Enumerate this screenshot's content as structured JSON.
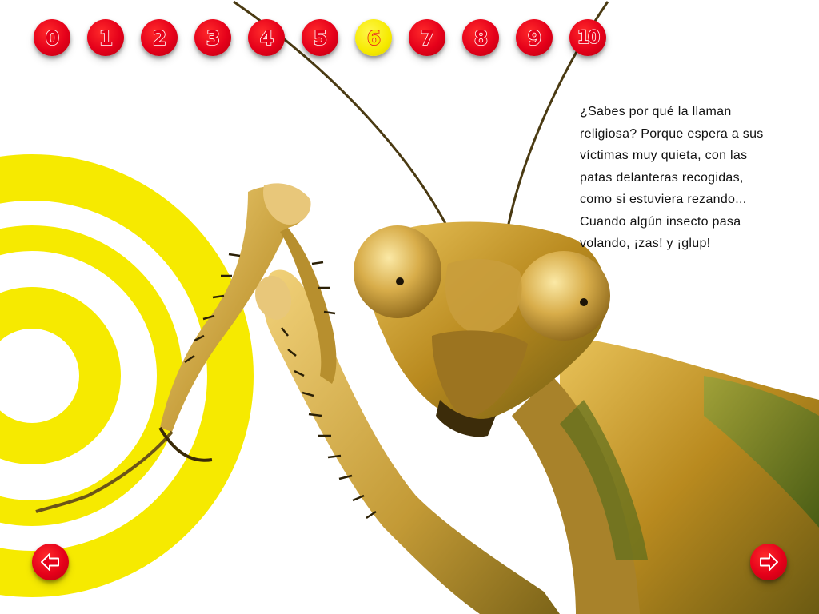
{
  "page_nav": {
    "pages": [
      "0",
      "1",
      "2",
      "3",
      "4",
      "5",
      "6",
      "7",
      "8",
      "9",
      "10"
    ],
    "current": "6"
  },
  "story": {
    "lines": [
      "¿Sabes por qué la llaman",
      "religiosa? Porque espera a sus",
      "víctimas muy quieta, con las",
      "patas delanteras recogidas,",
      "como si estuviera rezando...",
      "Cuando algún insecto pasa",
      "volando, ¡zas! y ¡glup!"
    ]
  },
  "navigation": {
    "prev_icon": "arrow-left-icon",
    "next_icon": "arrow-right-icon"
  },
  "colors": {
    "accent_red": "#e5001a",
    "accent_yellow": "#f6ea00",
    "background": "#ffffff",
    "text": "#111111"
  }
}
